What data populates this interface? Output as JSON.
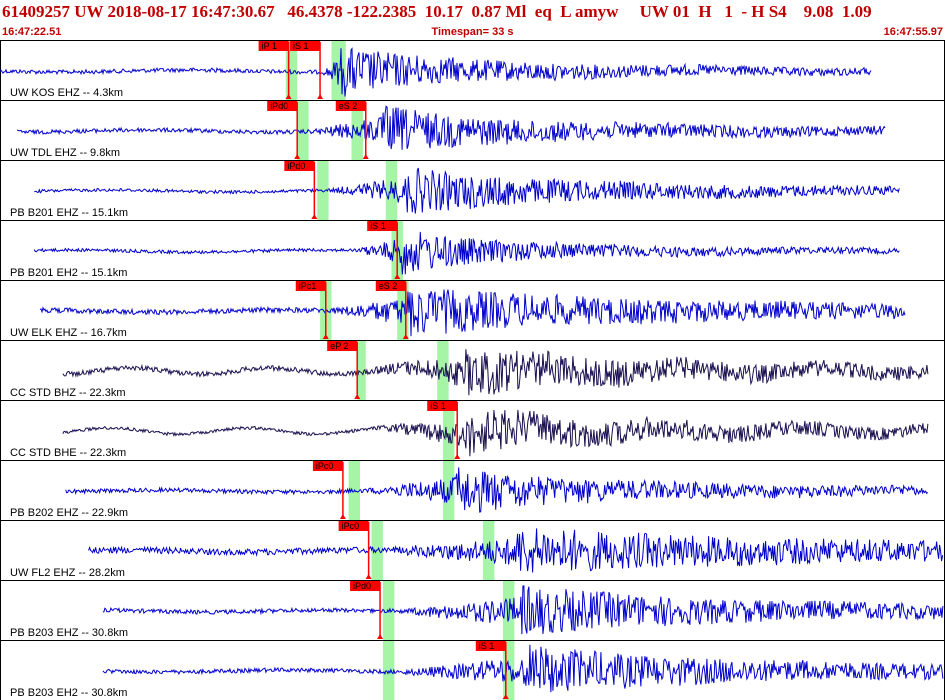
{
  "header": {
    "title": "61409257 UW 2018-08-17 16:47:30.67   46.4378 -122.2385  10.17  0.87 Ml  eq  L amyw     UW 01  H   1  - H S4    9.08  1.09",
    "start_time": "16:47:22.51",
    "timespan": "Timespan=  33 s",
    "end_time": "16:47:55.97"
  },
  "colors": {
    "title": "#c00000",
    "trace_blue": "#0000cc",
    "trace_dark": "#1a1050",
    "pick_red": "#ff0000",
    "window_green": "#a6f5a6"
  },
  "chart_data": {
    "type": "line",
    "x_range_s": [
      0,
      33
    ],
    "grid": false,
    "traces": [
      {
        "label": "UW KOS EHZ -- 4.3km",
        "color": "blue",
        "start": 0,
        "end": 30.5,
        "onset": 11.3,
        "peak_t": 11.9,
        "noise": 0.08,
        "amp": 0.95,
        "decay": 3.0,
        "greens": [
          [
            10.0,
            10.4
          ],
          [
            11.6,
            12.1
          ]
        ],
        "picks": [
          {
            "label": "iP 1",
            "t": 10.1
          },
          {
            "label": "iS 1",
            "t": 11.2
          }
        ]
      },
      {
        "label": "UW TDL EHZ -- 9.8km",
        "color": "blue",
        "start": 0.6,
        "end": 31,
        "onset": 10.9,
        "peak_t": 13.4,
        "noise": 0.08,
        "amp": 0.9,
        "decay": 3.5,
        "greens": [
          [
            10.4,
            10.8
          ],
          [
            12.3,
            12.7
          ]
        ],
        "picks": [
          {
            "label": "iPd0",
            "t": 10.4
          },
          {
            "label": "eS 2",
            "t": 12.8
          }
        ]
      },
      {
        "label": "PB B201 EHZ -- 15.1km",
        "color": "blue",
        "start": 1.2,
        "end": 31.5,
        "onset": 11.5,
        "peak_t": 14.2,
        "noise": 0.06,
        "amp": 0.9,
        "decay": 4.0,
        "greens": [
          [
            11.1,
            11.5
          ],
          [
            13.5,
            13.9
          ]
        ],
        "picks": [
          {
            "label": "iPd0",
            "t": 11.0
          }
        ]
      },
      {
        "label": "PB B201 EH2 -- 15.1km",
        "color": "blue",
        "start": 1.2,
        "end": 31.5,
        "onset": 12.5,
        "peak_t": 14.0,
        "noise": 0.06,
        "amp": 0.9,
        "decay": 2.5,
        "greens": [
          [
            13.7,
            14.1
          ]
        ],
        "picks": [
          {
            "label": "iS 1",
            "t": 13.9
          }
        ]
      },
      {
        "label": "UW ELK EHZ -- 16.7km",
        "color": "blue",
        "start": 1.4,
        "end": 31.7,
        "onset": 11.6,
        "peak_t": 14.2,
        "noise": 0.1,
        "amp": 0.9,
        "decay": 6.0,
        "greens": [
          [
            11.2,
            11.6
          ],
          [
            13.9,
            14.3
          ]
        ],
        "picks": [
          {
            "label": "iPc1",
            "t": 11.4
          },
          {
            "label": "eS 2",
            "t": 14.2
          }
        ]
      },
      {
        "label": "CC STD BHZ -- 22.3km",
        "color": "dark",
        "start": 2.2,
        "end": 32.5,
        "onset": 12.8,
        "peak_t": 16.3,
        "noise": 0.1,
        "amp": 0.85,
        "decay": 5.0,
        "greens": [
          [
            12.5,
            12.8
          ],
          [
            15.3,
            15.7
          ]
        ],
        "picks": [
          {
            "label": "eP 2",
            "t": 12.5
          }
        ]
      },
      {
        "label": "CC STD BHE -- 22.3km",
        "color": "dark",
        "start": 2.2,
        "end": 32.5,
        "onset": 13.0,
        "peak_t": 16.3,
        "noise": 0.06,
        "amp": 0.85,
        "decay": 5.0,
        "greens": [
          [
            15.5,
            15.9
          ]
        ],
        "picks": [
          {
            "label": "iS 1",
            "t": 16.0
          }
        ]
      },
      {
        "label": "PB B202 EHZ -- 22.9km",
        "color": "blue",
        "start": 2.3,
        "end": 32.5,
        "onset": 12.8,
        "peak_t": 15.9,
        "noise": 0.08,
        "amp": 0.9,
        "decay": 3.5,
        "greens": [
          [
            12.2,
            12.6
          ],
          [
            15.5,
            15.9
          ]
        ],
        "picks": [
          {
            "label": "iPc0",
            "t": 12.0
          }
        ]
      },
      {
        "label": "UW FL2 EHZ -- 28.2km",
        "color": "blue",
        "start": 3.1,
        "end": 33,
        "onset": 13.6,
        "peak_t": 18.0,
        "noise": 0.12,
        "amp": 0.85,
        "decay": 8.0,
        "greens": [
          [
            13.0,
            13.4
          ],
          [
            16.9,
            17.3
          ]
        ],
        "picks": [
          {
            "label": "iPc0",
            "t": 12.9
          }
        ]
      },
      {
        "label": "PB B203 EHZ -- 30.8km",
        "color": "blue",
        "start": 3.6,
        "end": 33,
        "onset": 14.0,
        "peak_t": 18.2,
        "noise": 0.08,
        "amp": 0.95,
        "decay": 5.0,
        "greens": [
          [
            13.4,
            13.8
          ],
          [
            17.6,
            18.0
          ]
        ],
        "picks": [
          {
            "label": "iPd0",
            "t": 13.3
          }
        ]
      },
      {
        "label": "PB B203 EH2 -- 30.8km",
        "color": "blue",
        "start": 3.6,
        "end": 33,
        "onset": 14.0,
        "peak_t": 18.4,
        "noise": 0.08,
        "amp": 0.95,
        "decay": 5.0,
        "greens": [
          [
            13.4,
            13.8
          ],
          [
            17.6,
            18.0
          ]
        ],
        "picks": [
          {
            "label": "iS 1",
            "t": 17.7
          }
        ]
      }
    ]
  }
}
